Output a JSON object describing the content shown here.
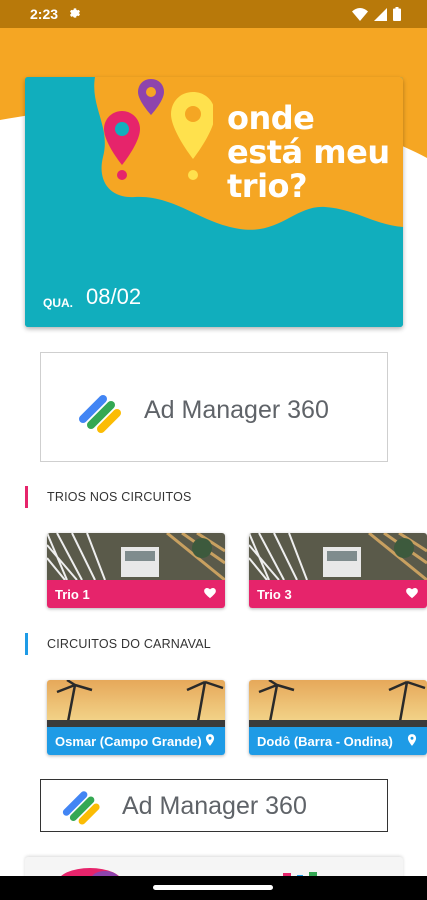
{
  "status_bar": {
    "time": "2:23"
  },
  "hero": {
    "title": "onde está meu trio?",
    "day_of_week": "QUA.",
    "date": "08/02"
  },
  "ads": [
    {
      "text": "Ad Manager 360"
    },
    {
      "text": "Ad Manager 360"
    }
  ],
  "sections": {
    "trios": {
      "label": "TRIOS NOS CIRCUITOS",
      "accent_color": "#e6246b",
      "items": [
        {
          "name": "Trio 1",
          "icon": "heart-icon"
        },
        {
          "name": "Trio 3",
          "icon": "heart-icon"
        }
      ]
    },
    "circuitos": {
      "label": "CIRCUITOS DO CARNAVAL",
      "accent_color": "#1e9be6",
      "items": [
        {
          "name": "Osmar (Campo Grande)",
          "icon": "location-pin-icon"
        },
        {
          "name": "Dodô (Barra - Ondina)",
          "icon": "location-pin-icon"
        }
      ]
    }
  },
  "colors": {
    "status_bar": "#b8790a",
    "orange": "#f5a623",
    "teal": "#11aebd",
    "pink": "#e6246b",
    "blue": "#1e9be6"
  }
}
